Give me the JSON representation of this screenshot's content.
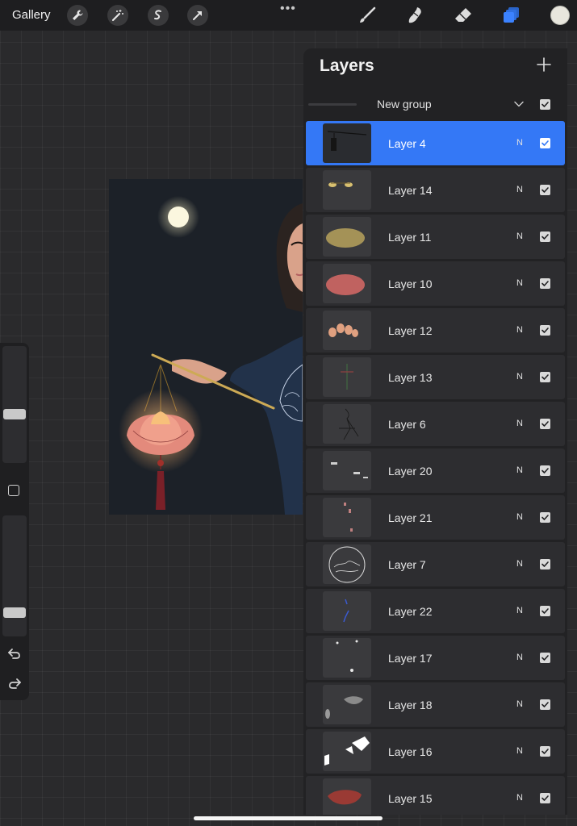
{
  "topbar": {
    "gallery_label": "Gallery",
    "left_tools": [
      "wrench-icon",
      "magic-wand-icon",
      "selection-icon",
      "transform-arrow-icon"
    ],
    "more_label": "•••",
    "right_tools": [
      "brush-icon",
      "smudge-icon",
      "eraser-icon",
      "layers-icon"
    ],
    "current_color": "#e8e6dd",
    "active_tool_color": "#3478f6"
  },
  "sidebar": {
    "brush_size_level": 0.4,
    "opacity_level": 0.15,
    "icons": [
      "modify-square-icon",
      "undo-icon",
      "redo-icon"
    ]
  },
  "layers_panel": {
    "title": "Layers",
    "add_icon": "plus-icon",
    "group": {
      "name": "New group",
      "visible": true
    },
    "active_color": "#3478f6",
    "layers": [
      {
        "name": "Layer 4",
        "blend": "N",
        "visible": true,
        "active": true
      },
      {
        "name": "Layer 14",
        "blend": "N",
        "visible": true,
        "active": false
      },
      {
        "name": "Layer 11",
        "blend": "N",
        "visible": true,
        "active": false
      },
      {
        "name": "Layer 10",
        "blend": "N",
        "visible": true,
        "active": false
      },
      {
        "name": "Layer 12",
        "blend": "N",
        "visible": true,
        "active": false
      },
      {
        "name": "Layer 13",
        "blend": "N",
        "visible": true,
        "active": false
      },
      {
        "name": "Layer 6",
        "blend": "N",
        "visible": true,
        "active": false
      },
      {
        "name": "Layer 20",
        "blend": "N",
        "visible": true,
        "active": false
      },
      {
        "name": "Layer 21",
        "blend": "N",
        "visible": true,
        "active": false
      },
      {
        "name": "Layer 7",
        "blend": "N",
        "visible": true,
        "active": false
      },
      {
        "name": "Layer 22",
        "blend": "N",
        "visible": true,
        "active": false
      },
      {
        "name": "Layer 17",
        "blend": "N",
        "visible": true,
        "active": false
      },
      {
        "name": "Layer 18",
        "blend": "N",
        "visible": true,
        "active": false
      },
      {
        "name": "Layer 16",
        "blend": "N",
        "visible": true,
        "active": false
      },
      {
        "name": "Layer 15",
        "blend": "N",
        "visible": true,
        "active": false
      }
    ]
  }
}
